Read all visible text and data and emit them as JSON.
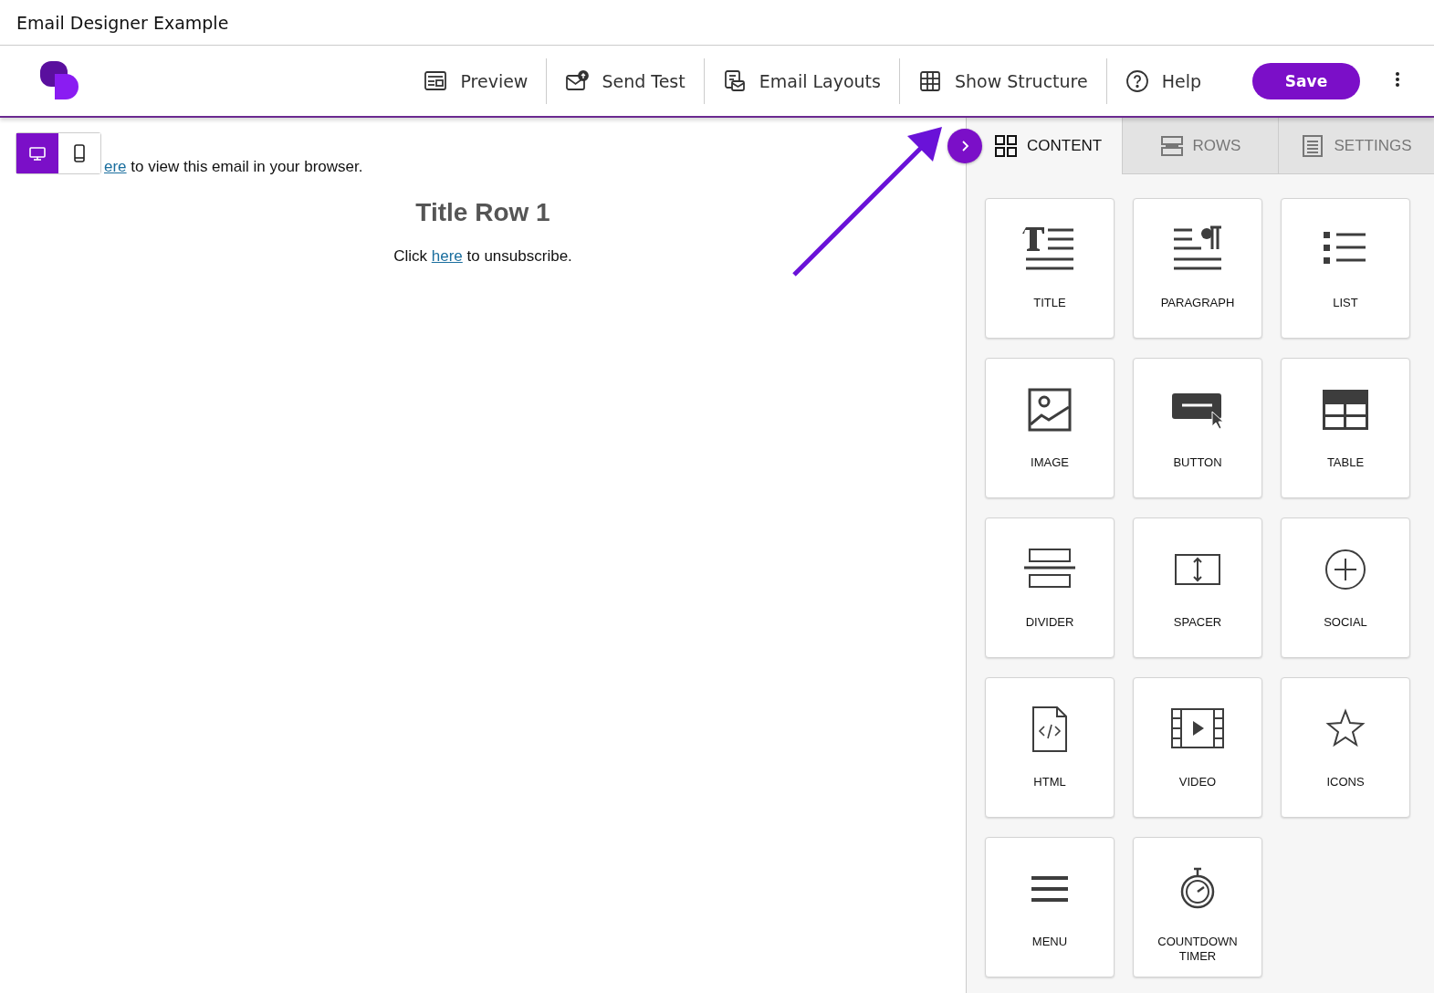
{
  "window": {
    "title": "Email Designer Example"
  },
  "toolbar": {
    "items": [
      {
        "kind": "preview",
        "label": "Preview"
      },
      {
        "kind": "send",
        "label": "Send Test"
      },
      {
        "kind": "layouts",
        "label": "Email Layouts"
      },
      {
        "kind": "structure",
        "label": "Show Structure"
      },
      {
        "kind": "help",
        "label": "Help"
      }
    ],
    "save": "Save"
  },
  "device_toggle": [
    {
      "kind": "desktop",
      "selected": true
    },
    {
      "kind": "mobile",
      "selected": false
    }
  ],
  "email": {
    "browser_link": "ere",
    "browser_text": "to view this email in your browser.",
    "title": "Title Row 1",
    "unsub_before": "Click",
    "unsub_link": "here",
    "unsub_after": "to unsubscribe."
  },
  "panel": {
    "tabs": [
      {
        "kind": "content",
        "label": "CONTENT",
        "selected": true
      },
      {
        "kind": "rows",
        "label": "ROWS",
        "selected": false
      },
      {
        "kind": "settings",
        "label": "SETTINGS",
        "selected": false
      }
    ],
    "tiles": [
      {
        "kind": "title",
        "label": "TITLE"
      },
      {
        "kind": "paragraph",
        "label": "PARAGRAPH"
      },
      {
        "kind": "list",
        "label": "LIST"
      },
      {
        "kind": "image",
        "label": "IMAGE"
      },
      {
        "kind": "button",
        "label": "BUTTON"
      },
      {
        "kind": "table",
        "label": "TABLE"
      },
      {
        "kind": "divider",
        "label": "DIVIDER"
      },
      {
        "kind": "spacer",
        "label": "SPACER"
      },
      {
        "kind": "social",
        "label": "SOCIAL"
      },
      {
        "kind": "html",
        "label": "HTML"
      },
      {
        "kind": "video",
        "label": "VIDEO"
      },
      {
        "kind": "icons",
        "label": "ICONS"
      },
      {
        "kind": "menu",
        "label": "MENU"
      },
      {
        "kind": "countdown",
        "label": "COUNTDOWN TIMER"
      }
    ]
  }
}
